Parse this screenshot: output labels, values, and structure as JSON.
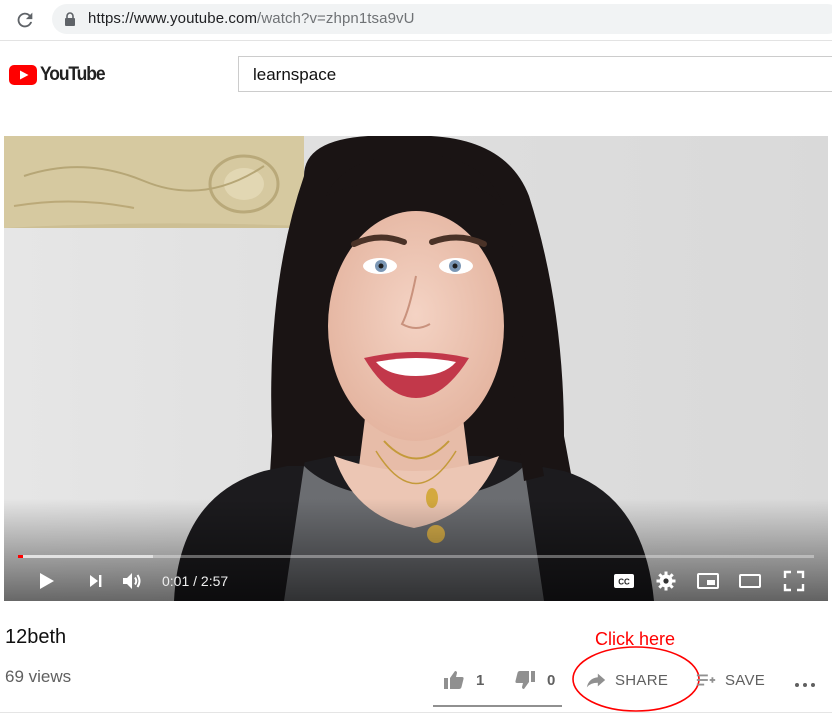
{
  "browser": {
    "url_host": "https://www.youtube.com",
    "url_path": "/watch?v=zhpn1tsa9vU",
    "reload_icon": "reload-icon",
    "lock_icon": "lock-icon"
  },
  "masthead": {
    "logo_text": "YouTube",
    "logo_color": "#ff0000",
    "search_value": "learnspace"
  },
  "player": {
    "current_time": "0:01",
    "duration": "2:57",
    "time_display": "0:01 / 2:57",
    "played_fraction": 0.006,
    "buffered_fraction": 0.17,
    "progress_color": "#ff0000",
    "controls": [
      "play-icon",
      "next-icon",
      "volume-icon",
      "captions-icon",
      "settings-icon",
      "miniplayer-icon",
      "theater-mode-icon",
      "fullscreen-icon"
    ]
  },
  "video": {
    "title": "12beth",
    "views": "69 views"
  },
  "actions": {
    "like_count": "1",
    "dislike_count": "0",
    "share_label": "SHARE",
    "save_label": "SAVE",
    "more_icon": "more-actions-icon"
  },
  "annotation": {
    "text": "Click here",
    "color": "#ff0000"
  }
}
